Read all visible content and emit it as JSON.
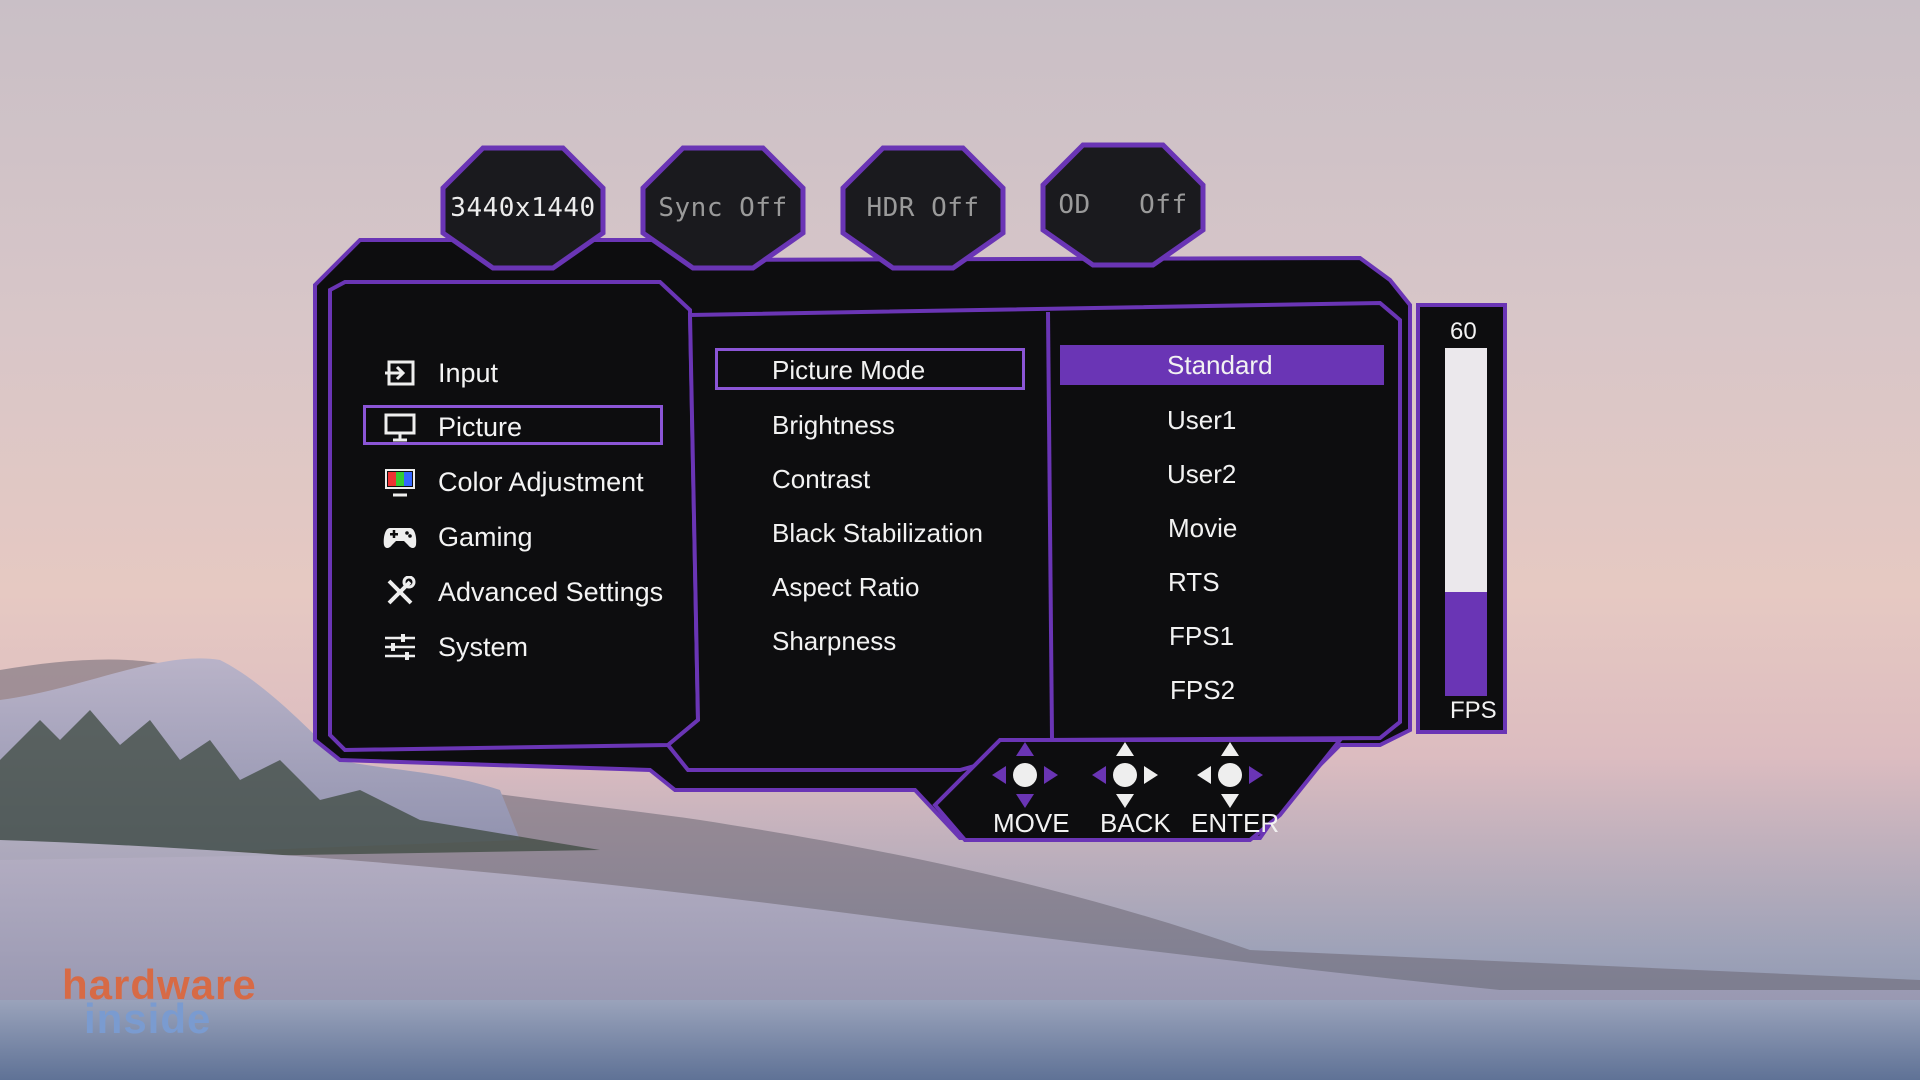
{
  "status_tabs": [
    {
      "id": "resolution",
      "label": "3440x1440",
      "active": true
    },
    {
      "id": "sync",
      "label": "Sync Off",
      "active": false
    },
    {
      "id": "hdr",
      "label": "HDR Off",
      "active": false
    },
    {
      "id": "od",
      "label": "OD   Off",
      "active": false
    }
  ],
  "main_menu": [
    {
      "label": "Input",
      "icon": "input-icon",
      "selected": false
    },
    {
      "label": "Picture",
      "icon": "monitor-icon",
      "selected": true
    },
    {
      "label": "Color Adjustment",
      "icon": "color-adjustment-icon",
      "selected": false
    },
    {
      "label": "Gaming",
      "icon": "gamepad-icon",
      "selected": false
    },
    {
      "label": "Advanced Settings",
      "icon": "tools-icon",
      "selected": false
    },
    {
      "label": "System",
      "icon": "sliders-icon",
      "selected": false
    }
  ],
  "sub_menu": [
    {
      "label": "Picture Mode",
      "selected": true
    },
    {
      "label": "Brightness",
      "selected": false
    },
    {
      "label": "Contrast",
      "selected": false
    },
    {
      "label": "Black Stabilization",
      "selected": false
    },
    {
      "label": "Aspect Ratio",
      "selected": false
    },
    {
      "label": "Sharpness",
      "selected": false
    }
  ],
  "options": [
    {
      "label": "Standard",
      "selected": true
    },
    {
      "label": "User1",
      "selected": false
    },
    {
      "label": "User2",
      "selected": false
    },
    {
      "label": "Movie",
      "selected": false
    },
    {
      "label": "RTS",
      "selected": false
    },
    {
      "label": "FPS1",
      "selected": false
    },
    {
      "label": "FPS2",
      "selected": false
    }
  ],
  "fps_meter": {
    "top_label": "60",
    "bottom_label": "FPS",
    "fill_fraction": 0.3
  },
  "controls": [
    {
      "label": "MOVE",
      "icon": "move-dpad-icon"
    },
    {
      "label": "BACK",
      "icon": "back-dpad-icon"
    },
    {
      "label": "ENTER",
      "icon": "enter-dpad-icon"
    }
  ],
  "watermark": {
    "line1": "hardware",
    "line2": "inside"
  },
  "colors": {
    "accent": "#6a35b5",
    "accent_light": "#8b55d6",
    "panel": "#0e0e10",
    "text": "#f2f2f2",
    "tab_inactive_text": "#9a9a9a"
  }
}
